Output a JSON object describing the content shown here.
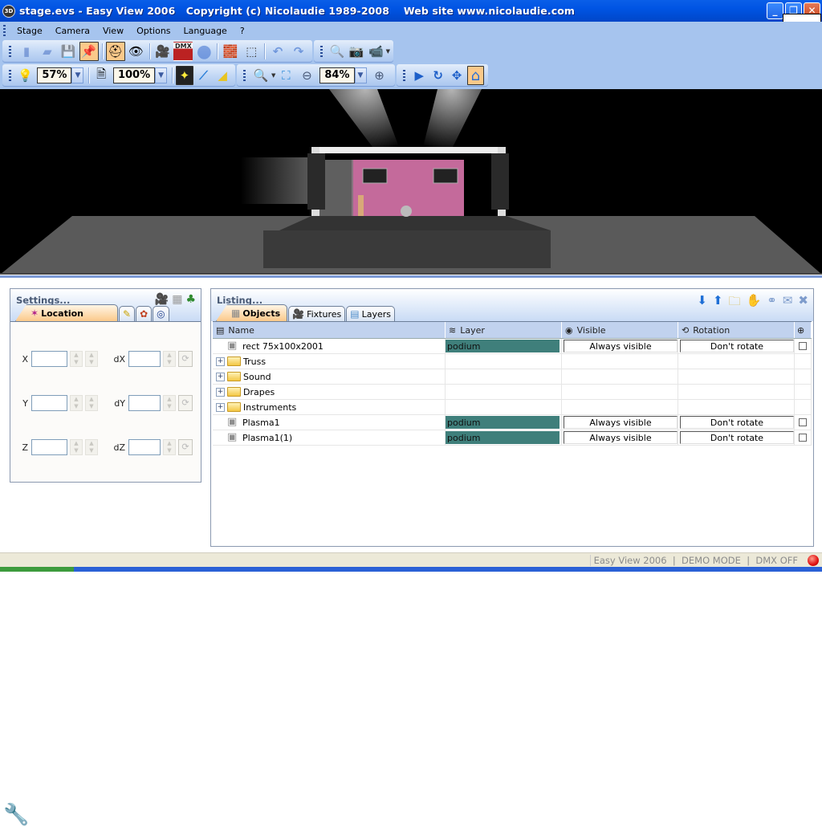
{
  "window": {
    "title": "stage.evs - Easy View 2006   Copyright (c) Nicolaudie 1989-2008    Web site www.nicolaudie.com",
    "app_icon": "3D",
    "buttons": {
      "minimize": "_",
      "restore": "❐",
      "close": "✕"
    }
  },
  "menu": {
    "items": [
      "Stage",
      "Camera",
      "View",
      "Options",
      "Language",
      "?"
    ]
  },
  "toolbar_main": {
    "buttons": [
      {
        "icon": "new-file-icon",
        "glyph": "▮",
        "state": "disabled"
      },
      {
        "icon": "open-folder-icon",
        "glyph": "▰",
        "state": "disabled"
      },
      {
        "icon": "save-icon",
        "glyph": "💾",
        "state": "disabled"
      },
      {
        "icon": "pushpin-icon",
        "glyph": "📌",
        "state": "active"
      },
      {
        "icon": "hardhat-icon",
        "glyph": "⛑",
        "state": "active"
      },
      {
        "icon": "eye-of-horus-icon",
        "glyph": "👁",
        "state": "normal"
      },
      {
        "icon": "moving-head-icon",
        "glyph": "🎥",
        "state": "normal"
      },
      {
        "icon": "dmx-icon",
        "glyph": "DMX",
        "state": "normal"
      },
      {
        "icon": "record-icon",
        "glyph": "●",
        "state": "disabled"
      },
      {
        "icon": "stage-object-icon",
        "glyph": "🧱",
        "state": "normal"
      },
      {
        "icon": "3d-box-icon",
        "glyph": "⬚",
        "state": "normal"
      },
      {
        "icon": "undo-icon",
        "glyph": "↶",
        "state": "disabled"
      },
      {
        "icon": "redo-icon",
        "glyph": "↷",
        "state": "disabled"
      }
    ]
  },
  "toolbar_capture": {
    "buttons": [
      {
        "icon": "search-icon",
        "glyph": "🔍",
        "state": "disabled"
      },
      {
        "icon": "camera-icon",
        "glyph": "📷",
        "state": "normal"
      },
      {
        "icon": "video-camera-icon",
        "glyph": "📹",
        "state": "normal"
      }
    ]
  },
  "toolbar_render": {
    "light_icon": "💡",
    "light_level": "57%",
    "texture_icon": "🗎",
    "texture_level": "100%",
    "beam_buttons": [
      {
        "icon": "beam-glow-icon",
        "glyph": "✦",
        "state": "active"
      },
      {
        "icon": "beam-line-icon",
        "glyph": "⟋",
        "state": "normal"
      },
      {
        "icon": "beam-cone-icon",
        "glyph": "◢",
        "state": "normal"
      }
    ]
  },
  "toolbar_zoom": {
    "zoom_in_icon": "🔍",
    "fit_icon": "⛶",
    "zoom_out_icon": "⊖",
    "zoom_level": "84%",
    "zoom_plus_icon": "⊕"
  },
  "toolbar_nav": {
    "buttons": [
      {
        "icon": "pointer-icon",
        "glyph": "▶",
        "state": "normal"
      },
      {
        "icon": "rotate-icon",
        "glyph": "↻",
        "state": "normal"
      },
      {
        "icon": "move-icon",
        "glyph": "✥",
        "state": "normal"
      },
      {
        "icon": "home-icon",
        "glyph": "⌂",
        "state": "active"
      }
    ]
  },
  "settings": {
    "title": "Settings...",
    "header_icons": [
      "🎥",
      "▦",
      "♣"
    ],
    "tabs": [
      {
        "label": "Location",
        "icon": "✶",
        "selected": true
      },
      {
        "label": "",
        "icon": "✎",
        "selected": false
      },
      {
        "label": "",
        "icon": "✿",
        "selected": false
      },
      {
        "label": "",
        "icon": "◎",
        "selected": false
      }
    ],
    "fields": [
      {
        "label": "X",
        "value": "",
        "dlabel": "dX",
        "dvalue": ""
      },
      {
        "label": "Y",
        "value": "",
        "dlabel": "dY",
        "dvalue": ""
      },
      {
        "label": "Z",
        "value": "",
        "dlabel": "dZ",
        "dvalue": ""
      }
    ]
  },
  "listing": {
    "title": "Listing...",
    "header_icons": [
      {
        "name": "move-down-icon",
        "glyph": "⬇",
        "color": "#1f6fd6"
      },
      {
        "name": "move-up-icon",
        "glyph": "⬆",
        "color": "#1f6fd6"
      },
      {
        "name": "new-folder-icon",
        "glyph": "🗀",
        "color": "#d8b23a"
      },
      {
        "name": "group-icon",
        "glyph": "✋",
        "color": "#7e9ccc"
      },
      {
        "name": "link-icon",
        "glyph": "⚭",
        "color": "#7e9ccc"
      },
      {
        "name": "package-icon",
        "glyph": "✉",
        "color": "#7e9ccc"
      },
      {
        "name": "delete-icon",
        "glyph": "✖",
        "color": "#7e9ccc"
      }
    ],
    "tabs": [
      {
        "label": "Objects",
        "icon": "▦",
        "selected": true
      },
      {
        "label": "Fixtures",
        "icon": "🎥",
        "selected": false
      },
      {
        "label": "Layers",
        "icon": "▤",
        "selected": false
      }
    ],
    "columns": [
      "Name",
      "Layer",
      "Visible",
      "Rotation",
      ""
    ],
    "rows": [
      {
        "type": "object",
        "name": "rect 75x100x2001",
        "layer": "podium",
        "visible": "Always visible",
        "rotation": "Don't rotate",
        "checked": false
      },
      {
        "type": "folder",
        "name": "Truss",
        "layer": "",
        "visible": "",
        "rotation": "",
        "checked": null
      },
      {
        "type": "folder",
        "name": "Sound",
        "layer": "",
        "visible": "",
        "rotation": "",
        "checked": null
      },
      {
        "type": "folder",
        "name": "Drapes",
        "layer": "",
        "visible": "",
        "rotation": "",
        "checked": null
      },
      {
        "type": "folder",
        "name": "Instruments",
        "layer": "",
        "visible": "",
        "rotation": "",
        "checked": null
      },
      {
        "type": "object",
        "name": "Plasma1",
        "layer": "podium",
        "visible": "Always visible",
        "rotation": "Don't rotate",
        "checked": false
      },
      {
        "type": "object",
        "name": "Plasma1(1)",
        "layer": "podium",
        "visible": "Always visible",
        "rotation": "Don't rotate",
        "checked": false
      }
    ]
  },
  "status": {
    "text": "Easy View 2006  |  DEMO MODE  |  DMX OFF",
    "led_color": "#e01010"
  },
  "colors": {
    "accent_active": "#fbc98a",
    "layer_cell": "#3f7f7b",
    "titlebar": "#0054e3"
  }
}
